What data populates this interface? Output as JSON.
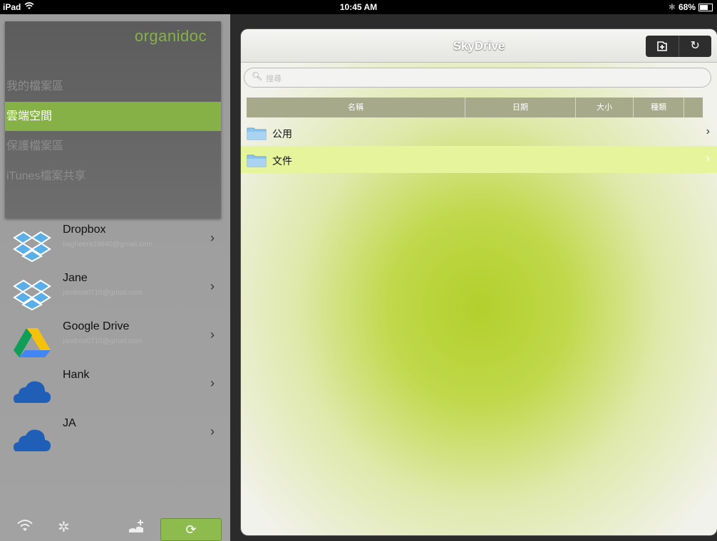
{
  "status_bar": {
    "device": "iPad",
    "time": "10:45 AM",
    "battery": "68%",
    "battery_level": 0.68
  },
  "sidebar": {
    "logo": "organidoc",
    "menu": [
      {
        "label": "我的檔案區",
        "active": false
      },
      {
        "label": "雲端空間",
        "active": true
      },
      {
        "label": "保護檔案區",
        "active": false
      },
      {
        "label": "iTunes檔案共享",
        "active": false
      }
    ],
    "accounts": [
      {
        "name": "Dropbox",
        "email": "bagheera19840@gmail.com",
        "icon": "dropbox-icon"
      },
      {
        "name": "Jane",
        "email": "jandrea0710@gmail.com",
        "icon": "dropbox-icon"
      },
      {
        "name": "Google Drive",
        "email": "jandrea0710@gmail.com",
        "icon": "google-drive-icon"
      },
      {
        "name": "Hank",
        "email": "",
        "icon": "skydrive-cloud-icon"
      },
      {
        "name": "JA",
        "email": "",
        "icon": "skydrive-cloud-icon"
      }
    ],
    "colors": {
      "accent": "#86b147"
    }
  },
  "main": {
    "title": "SkyDrive",
    "search_placeholder": "搜尋",
    "columns": [
      "名稱",
      "日期",
      "大小",
      "種類"
    ],
    "rows": [
      {
        "name": "公用",
        "selected": false
      },
      {
        "name": "文件",
        "selected": true
      }
    ]
  }
}
